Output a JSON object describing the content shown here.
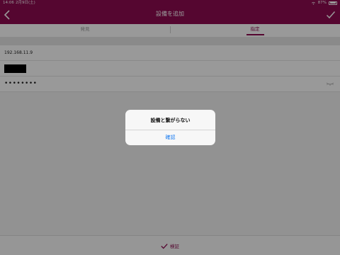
{
  "status_bar": {
    "time": "14:06",
    "date": "2月9日(土)",
    "battery": "87%"
  },
  "nav": {
    "title": "設備を追加"
  },
  "tabs": [
    {
      "label": "発見"
    },
    {
      "label": "指定"
    }
  ],
  "form": {
    "ip": "192.168.11.9",
    "password": "••••••••"
  },
  "bottom": {
    "verify_label": "検証"
  },
  "alert": {
    "message": "設備と繋がらない",
    "confirm_label": "確認"
  },
  "colors": {
    "brand": "#8e0b50",
    "link": "#1a7cf0"
  }
}
